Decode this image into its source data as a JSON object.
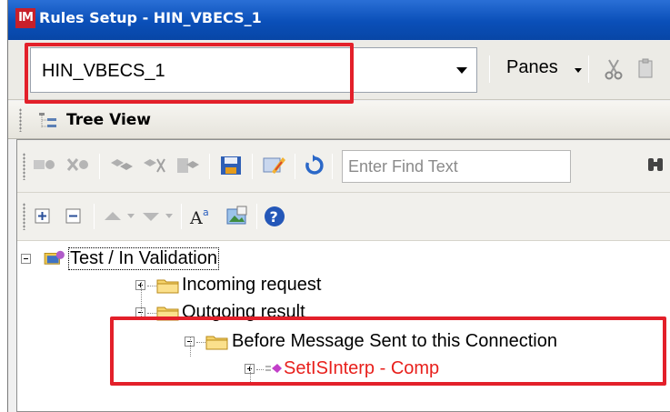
{
  "window": {
    "app_logo_text": "IM",
    "title": "Rules Setup - HIN_VBECS_1"
  },
  "connection_bar": {
    "selected_connection": "HIN_VBECS_1",
    "panes_label": "Panes"
  },
  "tree_view": {
    "header_title": "Tree View",
    "find_placeholder": "Enter Find Text"
  },
  "tree": {
    "root": {
      "label": "Test / In Validation",
      "expanded": true
    },
    "nodes": [
      {
        "label": "Incoming request",
        "expanded": false,
        "type": "folder"
      },
      {
        "label": "Outgoing result",
        "expanded": true,
        "type": "folder"
      },
      {
        "label": "Before Message Sent to this Connection",
        "expanded": true,
        "type": "folder"
      },
      {
        "label": "SetISInterp - Comp",
        "expanded": false,
        "type": "rule",
        "color": "#e8201c"
      }
    ]
  },
  "colors": {
    "title_bar": "#0a4fb8",
    "highlight": "#e3202a",
    "rule_text": "#e8201c"
  }
}
